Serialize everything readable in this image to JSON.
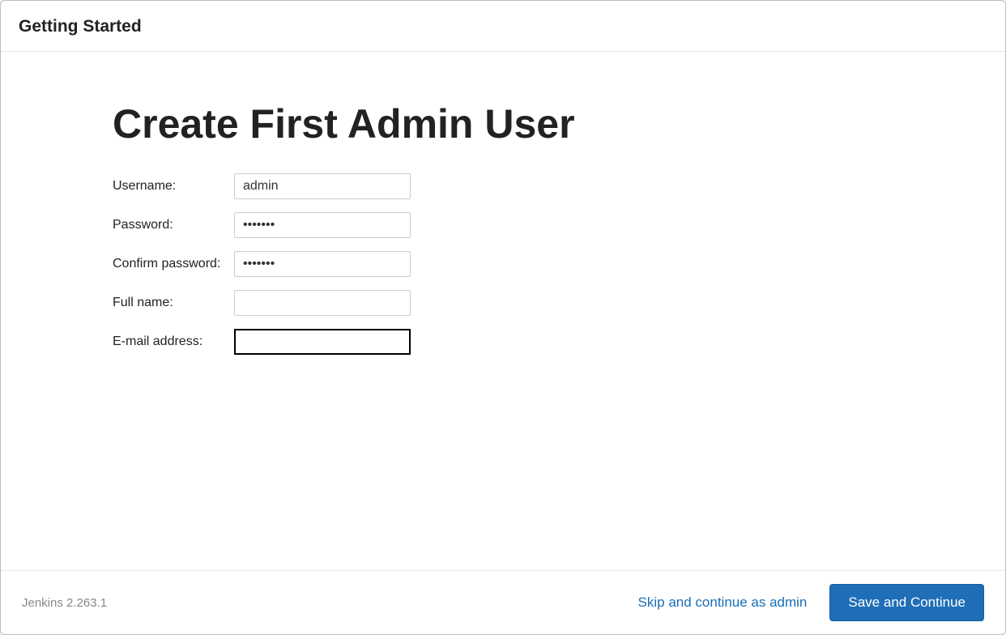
{
  "header": {
    "title": "Getting Started"
  },
  "main": {
    "title": "Create First Admin User",
    "fields": {
      "username": {
        "label": "Username:",
        "value": "admin"
      },
      "password": {
        "label": "Password:",
        "value": "•••••••"
      },
      "confirm_password": {
        "label": "Confirm password:",
        "value": "•••••••"
      },
      "full_name": {
        "label": "Full name:",
        "value": ""
      },
      "email": {
        "label": "E-mail address:",
        "value": ""
      }
    }
  },
  "footer": {
    "version": "Jenkins 2.263.1",
    "skip_label": "Skip and continue as admin",
    "save_label": "Save and Continue"
  }
}
